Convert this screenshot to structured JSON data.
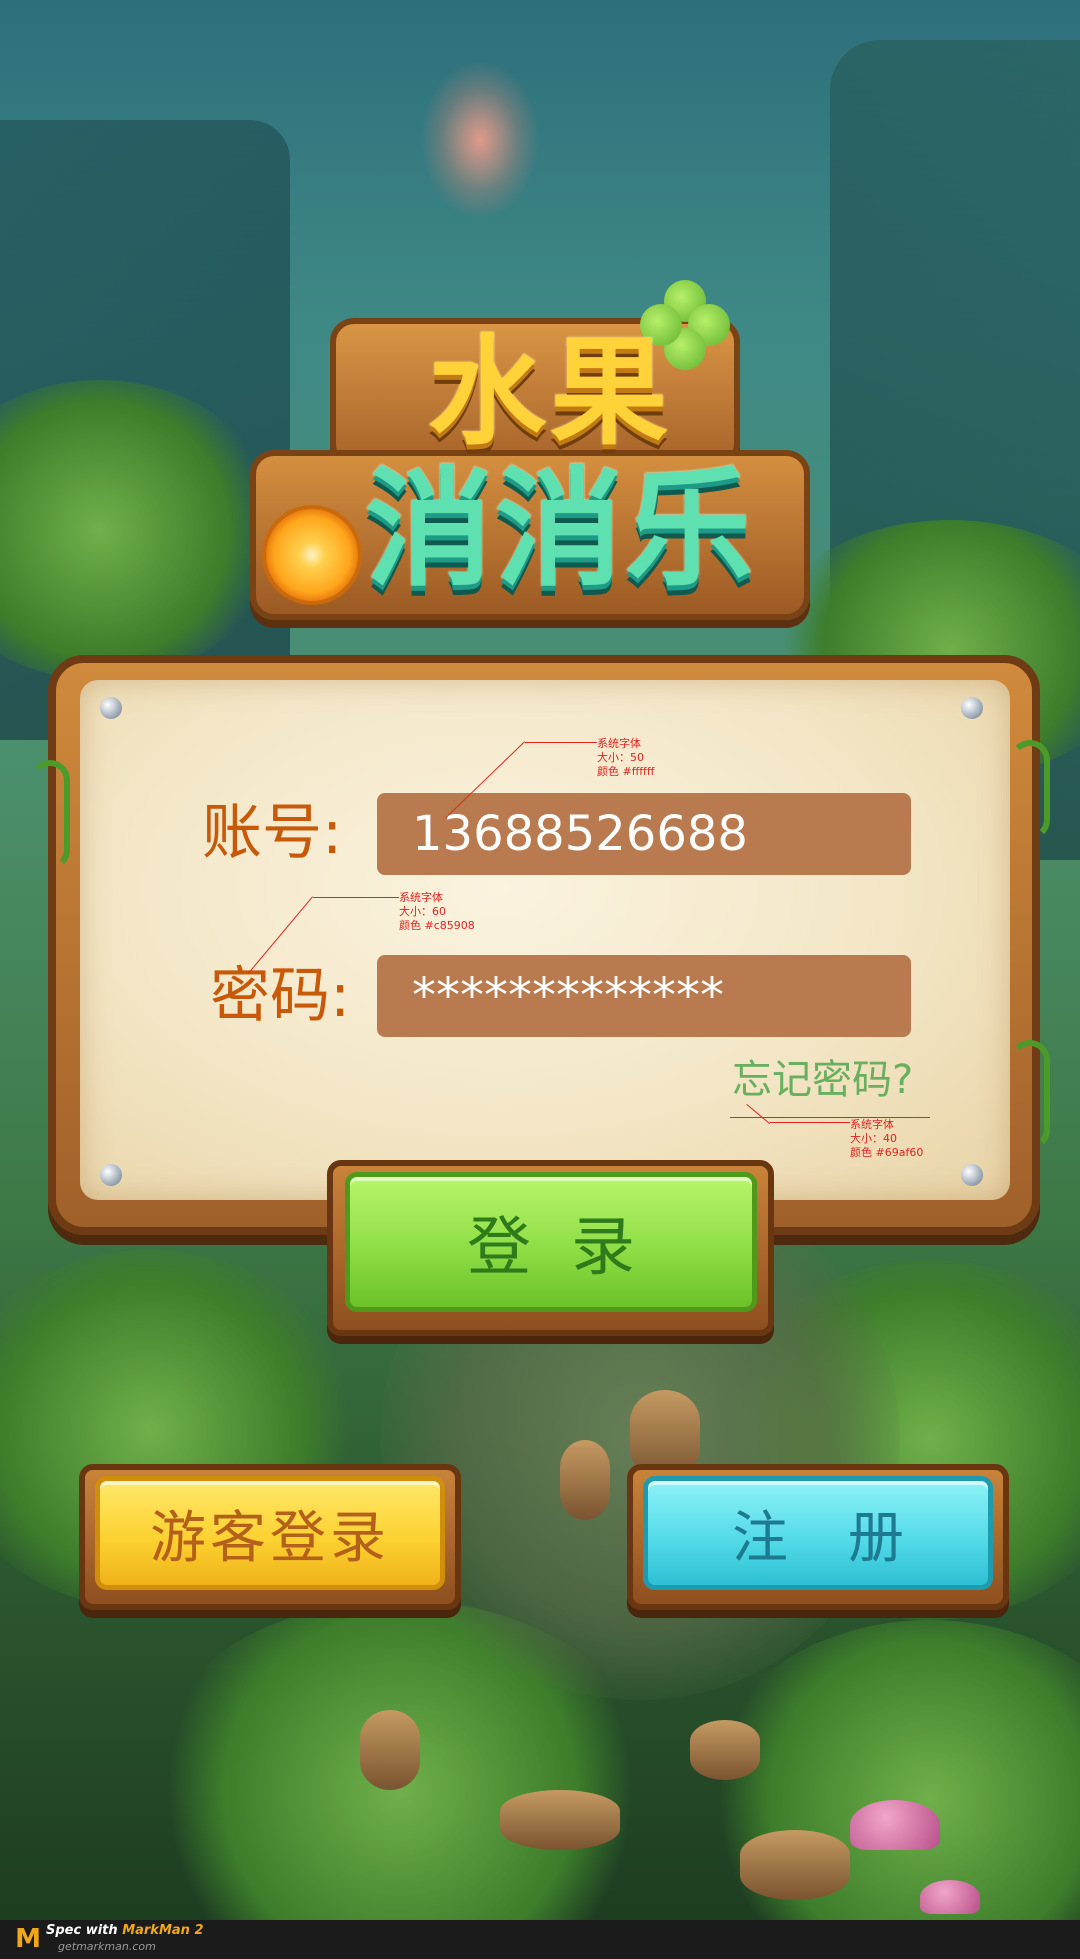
{
  "logo": {
    "title_top": "水果",
    "title_bottom": "消消乐"
  },
  "login_form": {
    "account_label": "账号:",
    "account_value": "13688526688",
    "password_label": "密码:",
    "password_value": "*************",
    "forgot_password": "忘记密码?"
  },
  "buttons": {
    "login": "登录",
    "guest_login": "游客登录",
    "register": "注册"
  },
  "spec_annotations": {
    "account_input": {
      "font": "系统字体",
      "size": "大小：50",
      "color": "颜色 #ffffff"
    },
    "field_label": {
      "font": "系统字体",
      "size": "大小：60",
      "color": "颜色 #c85908"
    },
    "forgot_link": {
      "font": "系统字体",
      "size": "大小：40",
      "color": "颜色 #69af60"
    }
  },
  "footer": {
    "line1_prefix": "Spec with ",
    "line1_brand": "MarkMan 2",
    "line2": "getmarkman.com"
  },
  "colors": {
    "label": "#c85908",
    "input_text": "#ffffff",
    "input_bg": "#b97a4f",
    "forgot_link": "#69af60",
    "annotation": "#e0241f"
  }
}
